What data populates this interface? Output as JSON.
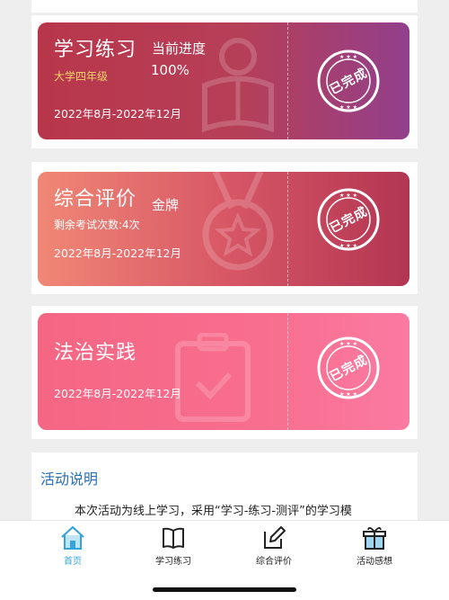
{
  "cards": [
    {
      "title": "学习练习",
      "progress_label": "当前进度",
      "progress_value": "100%",
      "tag": "大学四年级",
      "date": "2022年8月-2022年12月",
      "stamp": "已完成",
      "bg_icon": "reading-person-icon"
    },
    {
      "title": "综合评价",
      "medal": "金牌",
      "remaining": "剩余考试次数:4次",
      "date": "2022年8月-2022年12月",
      "stamp": "已完成",
      "bg_icon": "medal-star-icon"
    },
    {
      "title": "法治实践",
      "date": "2022年8月-2022年12月",
      "stamp": "已完成",
      "bg_icon": "clipboard-check-icon"
    }
  ],
  "info": {
    "title": "活动说明",
    "text": "本次活动为线上学习，采用“学习-练习-测评”的学习模"
  },
  "tabs": [
    {
      "label": "首页",
      "icon": "home-icon",
      "active": true
    },
    {
      "label": "学习练习",
      "icon": "book-icon",
      "active": false
    },
    {
      "label": "综合评价",
      "icon": "edit-icon",
      "active": false
    },
    {
      "label": "活动感想",
      "icon": "gift-box-icon",
      "active": false
    }
  ],
  "colors": {
    "accent": "#36a4d8",
    "info_title": "#2a6fb3",
    "tag_yellow": "#f5d36a"
  }
}
